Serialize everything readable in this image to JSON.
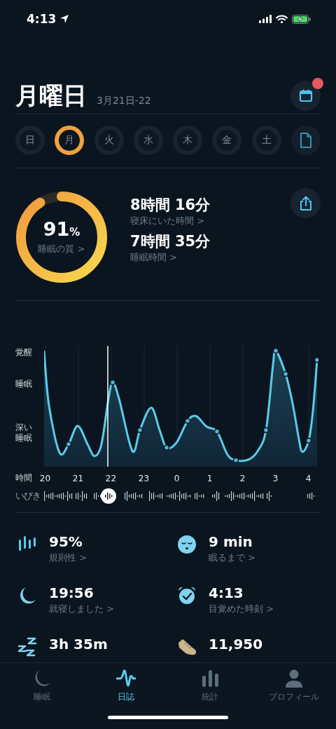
{
  "status_bar": {
    "time": "4:13"
  },
  "header": {
    "title": "月曜日",
    "date_range": "3月21日-22"
  },
  "days": [
    {
      "label": "日",
      "selected": false
    },
    {
      "label": "月",
      "selected": true
    },
    {
      "label": "火",
      "selected": false
    },
    {
      "label": "水",
      "selected": false
    },
    {
      "label": "木",
      "selected": false
    },
    {
      "label": "金",
      "selected": false
    },
    {
      "label": "土",
      "selected": false
    }
  ],
  "quality": {
    "value": "91",
    "unit": "%",
    "label": "睡眠の質",
    "chevron": ">"
  },
  "durations": [
    {
      "value": "8時間 16分",
      "label": "寝床にいた時間",
      "chevron": ">"
    },
    {
      "value": "7時間 35分",
      "label": "睡眠時間",
      "chevron": ">"
    }
  ],
  "hypnogram": {
    "y_labels": [
      "覚醒",
      "睡眠",
      "深い睡眠"
    ],
    "x_title": "時間",
    "x_labels": [
      "20",
      "21",
      "22",
      "23",
      "0",
      "1",
      "2",
      "3",
      "4"
    ],
    "snore_label": "いびき"
  },
  "stats": [
    {
      "value": "95%",
      "label": "規則性",
      "chevron": ">"
    },
    {
      "value": "9 min",
      "label": "眠るまで",
      "chevron": ">"
    },
    {
      "value": "19:56",
      "label": "就寝しました",
      "chevron": ">"
    },
    {
      "value": "4:13",
      "label": "目覚めた時刻",
      "chevron": ">"
    },
    {
      "value": "3h 35m"
    },
    {
      "value": "11,950"
    }
  ],
  "tabs": [
    {
      "label": "睡眠",
      "selected": false
    },
    {
      "label": "日誌",
      "selected": true
    },
    {
      "label": "統計",
      "selected": false
    },
    {
      "label": "プロフィール",
      "selected": false
    }
  ]
}
